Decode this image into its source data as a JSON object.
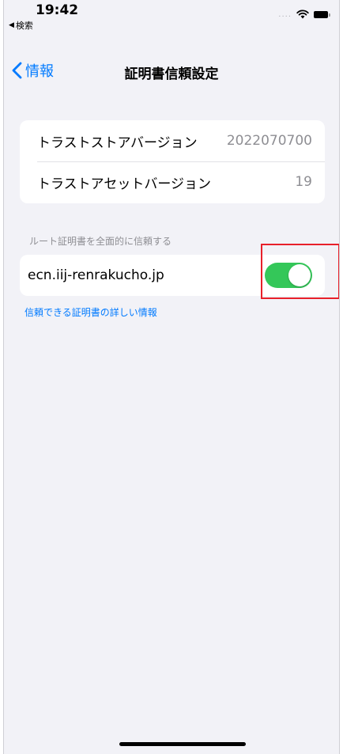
{
  "status_bar": {
    "time": "19:42",
    "back_app": "検索",
    "back_icon": "back-triangle-icon",
    "signal": "....",
    "wifi_icon": "wifi-icon",
    "battery_icon": "battery-icon"
  },
  "nav": {
    "back_label": "情報",
    "back_icon": "chevron-left-icon",
    "title": "証明書信頼設定"
  },
  "versions": {
    "rows": [
      {
        "label": "トラストストアバージョン",
        "value": "2022070700"
      },
      {
        "label": "トラストアセットバージョン",
        "value": "19"
      }
    ]
  },
  "trust_section": {
    "header": "ルート証明書を全面的に信頼する",
    "items": [
      {
        "domain": "ecn.iij-renrakucho.jp",
        "enabled": true
      }
    ]
  },
  "footer": {
    "link": "信頼できる証明書の詳しい情報"
  },
  "colors": {
    "accent": "#007aff",
    "toggle_on": "#34c759",
    "highlight": "#e8202a",
    "background": "#f2f2f7"
  }
}
